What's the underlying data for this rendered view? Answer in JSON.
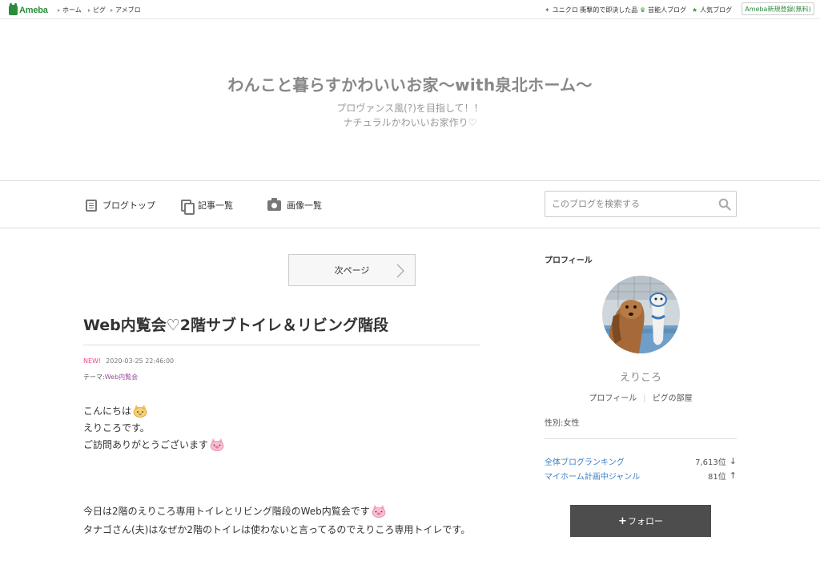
{
  "global_nav": {
    "logo": "Ameba",
    "links": [
      "ホーム",
      "ピグ",
      "アメブロ"
    ],
    "right_links": [
      "ユニクロ 衝撃的で即決した品",
      "芸能人ブログ",
      "人気ブログ"
    ],
    "register": "Ameba新規登録(無料)"
  },
  "header": {
    "title": "わんこと暮らすかわいいお家〜with泉北ホーム〜",
    "description_line1": "プロヴァンス風(?)を目指して！！",
    "description_line2": "ナチュラルかわいいお家作り♡"
  },
  "nav": {
    "items": [
      "ブログトップ",
      "記事一覧",
      "画像一覧"
    ],
    "search_placeholder": "このブログを検索する"
  },
  "main": {
    "next_page": "次ページ",
    "entry": {
      "title": "Web内覧会♡2階サブトイレ＆リビング階段",
      "new_badge": "NEW!",
      "date": "2020-03-25 22:46:00",
      "theme_label": "テーマ:",
      "theme": "Web内覧会",
      "body": [
        "こんにちは",
        "えりころです。",
        "ご訪問ありがとうございます",
        "今日は2階のえりころ専用トイレとリビング階段のWeb内覧会です",
        "タナゴさん(夫)はなぜか2階のトイレは使わないと言ってるのでえりころ専用トイレです。"
      ]
    }
  },
  "sidebar": {
    "heading": "プロフィール",
    "nickname": "えりころ",
    "links": [
      "プロフィール",
      "ピグの部屋"
    ],
    "gender": "性別:女性",
    "rankings": [
      {
        "label": "全体ブログランキング",
        "value": "7,613位",
        "arrow": "↓"
      },
      {
        "label": "マイホーム計画中ジャンル",
        "value": "81位",
        "arrow": "↑"
      }
    ],
    "follow": "フォロー"
  },
  "colors": {
    "brand_green": "#2d8c3c",
    "link_blue": "#3b7fc4",
    "new_pink": "#e84c8b",
    "theme_purple": "#9b4a9b",
    "follow_bg": "#4d4d4d"
  }
}
